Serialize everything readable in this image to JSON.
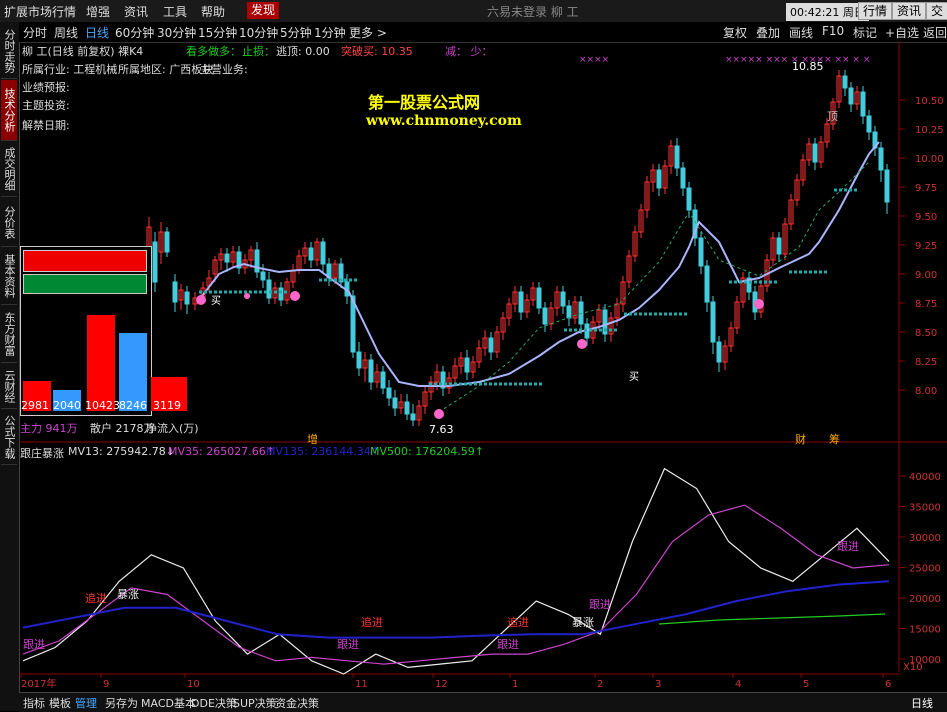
{
  "topbar": {
    "menus": [
      "扩展市场行情",
      "增强",
      "资讯",
      "工具",
      "帮助"
    ],
    "active_menu": "发现",
    "center_title": "六易未登录    柳 工",
    "clock": "00:42:21 周日",
    "right_buttons": [
      "行情",
      "资讯",
      "交易"
    ]
  },
  "left_tabs": [
    "分时走势",
    "技术分析",
    "成交明细",
    "分价表",
    "基本资料",
    "东方财富",
    "云财经",
    "公式下载"
  ],
  "period": {
    "items": [
      "分时",
      "周线",
      "日线",
      "60分钟",
      "30分钟",
      "15分钟",
      "10分钟",
      "5分钟",
      "1分钟",
      "更多 >"
    ],
    "selected": "日线",
    "right": [
      "复权",
      "叠加",
      "画线",
      "F10",
      "标记",
      "+自选",
      "返回"
    ]
  },
  "info": {
    "stock_line": "柳 工(日线 前复权) 裸K4",
    "signals": {
      "kanduo": "看多做多：",
      "zhisun": "止损：",
      "xuanding": "逃顶: 0.00",
      "tupo": "突破买: 10.35",
      "shaobi": "减：  少："
    },
    "industry": "所属行业: 工程机械",
    "region": "所属地区: 广西板块",
    "business": "主营业务:",
    "yeji": "业绩预报:",
    "zhuti": "主题投资:",
    "jiejin": "解禁日期:"
  },
  "watermark": {
    "title": "第一股票公式网",
    "url": "www.chnmoney.com"
  },
  "flow_panel": {
    "values": [
      "2981",
      "2040",
      "10423",
      "8246",
      "3119"
    ],
    "zhuli": "主力 941万",
    "sanhu": "散户 2178万",
    "jinliu": "净流入(万)"
  },
  "main_chart_labels": {
    "high": "10.85",
    "low": "7.63",
    "buy1": "买",
    "buy2": "买",
    "top": "顶",
    "zeng": "增",
    "cai": "财",
    "chou": "筹"
  },
  "indicator": {
    "name": "跟庄暴涨",
    "mv13": "MV13: 275942.78↓",
    "mv35": "MV35: 265027.66↑",
    "mv135": "MV135: 236144.34↑",
    "mv500": "MV500: 176204.59↑",
    "labels": [
      "跟进",
      "追进",
      "暴涨",
      "追进",
      "跟进",
      "追进",
      "跟进",
      "暴涨",
      "跟进",
      "跟进"
    ],
    "corner": "X10"
  },
  "axis": {
    "price_ticks": [
      "10.50",
      "10.25",
      "10.00",
      "9.75",
      "9.50",
      "9.25",
      "9.00",
      "8.75",
      "8.50",
      "8.25",
      "8.00"
    ],
    "vol_ticks": [
      "40000",
      "35000",
      "30000",
      "25000",
      "20000",
      "15000",
      "10000"
    ],
    "months": [
      "2017年",
      "9",
      "10",
      "11",
      "12",
      "1",
      "2",
      "3",
      "4",
      "5",
      "6"
    ]
  },
  "bottombar": {
    "items": [
      "指标",
      "模板",
      "管理",
      "另存为",
      "MACD基本",
      "DDE决策",
      "SUP决策",
      "资金决策"
    ],
    "selected": "管理",
    "right": "日线"
  },
  "chart_data": {
    "type": "line",
    "title": "跟庄暴涨",
    "series": [
      {
        "name": "MV13",
        "values": [
          12000,
          14000,
          18000,
          24000,
          28000,
          26000,
          18000,
          13000,
          16000,
          12000,
          10000,
          13000,
          11000,
          11500,
          12000,
          16500,
          21000,
          19000,
          16000,
          30000,
          41000,
          38000,
          30000,
          26000,
          24000,
          28000,
          32000,
          27000
        ]
      },
      {
        "name": "MV35",
        "values": [
          13000,
          15000,
          19000,
          23000,
          22000,
          18000,
          14000,
          12000,
          12500,
          12000,
          11500,
          12000,
          12500,
          13000,
          13000,
          14500,
          16500,
          22000,
          30000,
          34000,
          35500,
          32000,
          28000,
          26000,
          26500
        ]
      },
      {
        "name": "MV135",
        "values": [
          17000,
          18500,
          20000,
          20000,
          18000,
          16000,
          15500,
          15500,
          15500,
          15800,
          16000,
          16000,
          17500,
          19000,
          21000,
          22500,
          23500,
          24000
        ]
      }
    ],
    "ylim": [
      10000,
      42000
    ]
  }
}
